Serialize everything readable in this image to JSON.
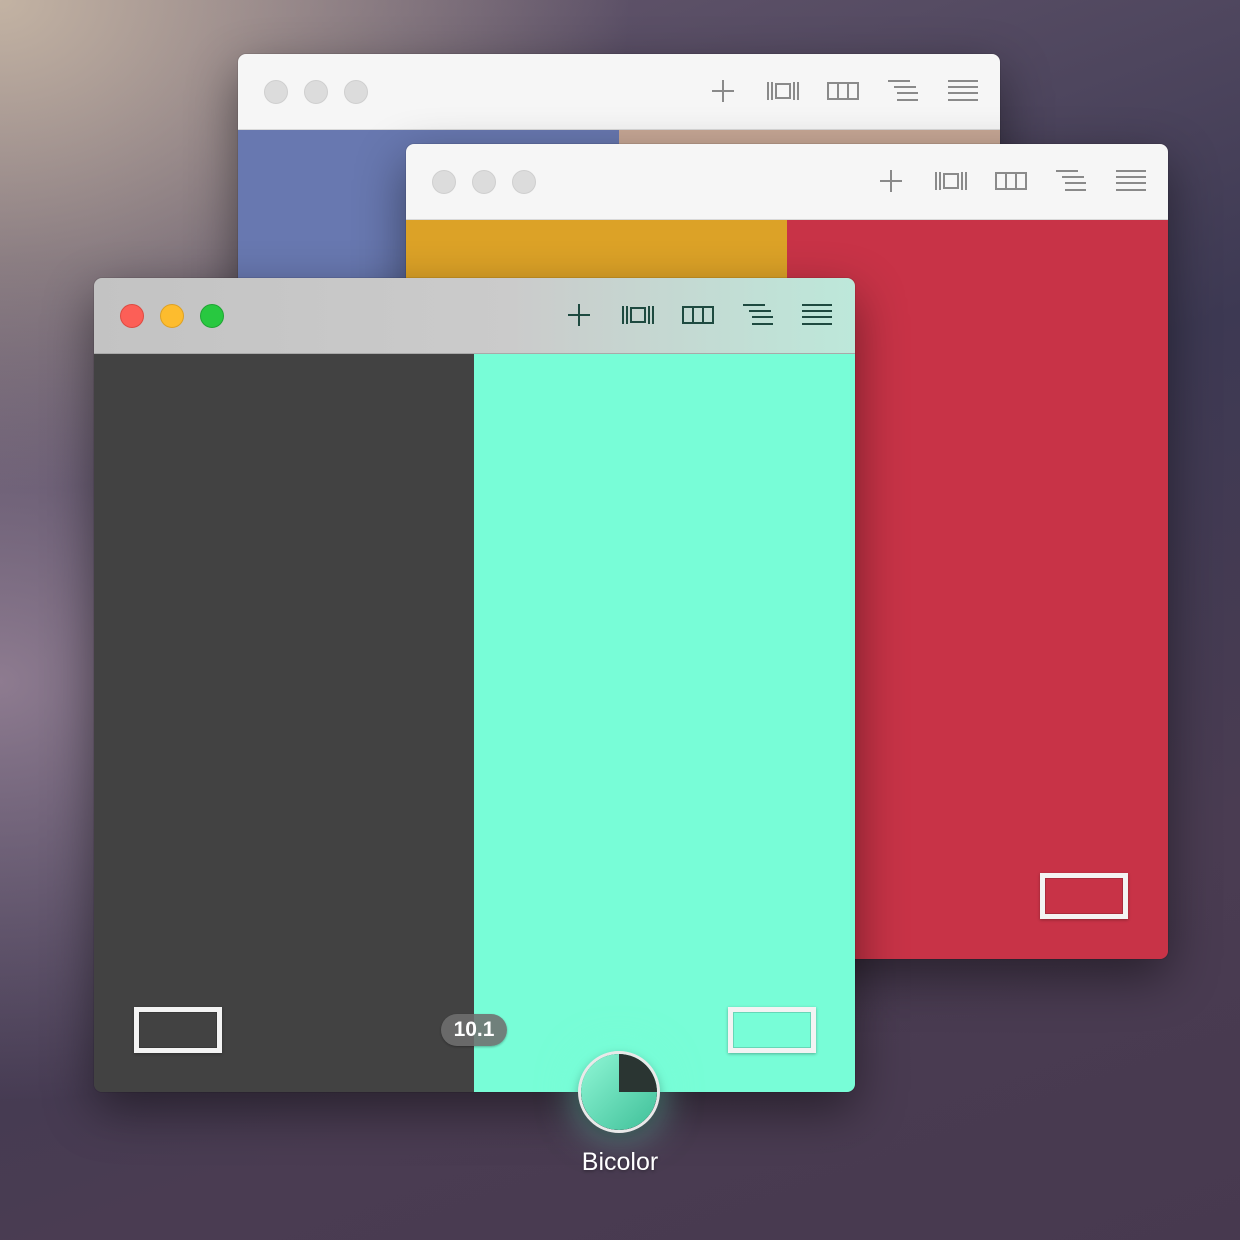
{
  "mode": {
    "label": "Bicolor",
    "value_badge": "10.1"
  },
  "toolbar_icons": [
    "add-icon",
    "stretch-icon",
    "columns-icon",
    "list-indent-icon",
    "list-icon"
  ],
  "colors": {
    "back_window": {
      "left": "#6878b0",
      "right": "#c8a896"
    },
    "middle_window": {
      "left": "#dca227",
      "right": "#c83347"
    },
    "front_window": {
      "left": "#424242",
      "right": "#78fdd7"
    },
    "traffic_close": "#fc5f57",
    "traffic_minimize": "#fdbc2e",
    "traffic_zoom": "#28c840"
  }
}
